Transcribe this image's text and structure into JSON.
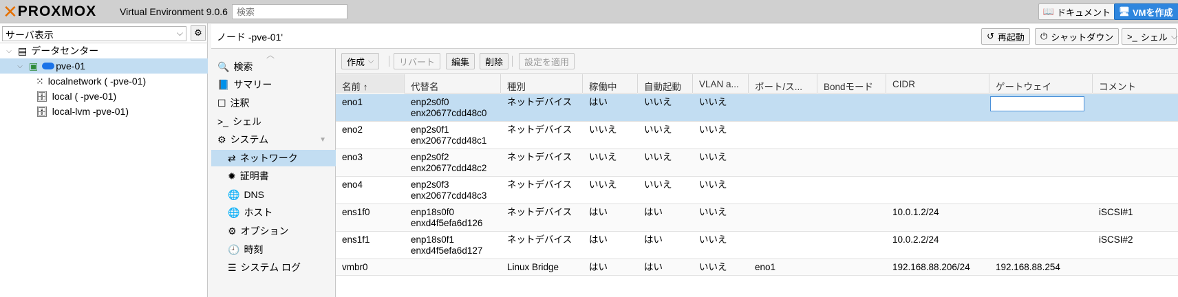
{
  "app": {
    "logo": "PROXMOX",
    "version": "Virtual Environment 9.0.6",
    "search_placeholder": "検索",
    "docs_label": "ドキュメント",
    "create_vm_label": "VMを作成"
  },
  "tree": {
    "view_label": "サーバ表示",
    "items": [
      {
        "label": "データセンター"
      },
      {
        "label": "pve-01"
      },
      {
        "label": "localnetwork (   -pve-01)"
      },
      {
        "label": "local (   -pve-01)"
      },
      {
        "label": "local-lvm   -pve-01)"
      }
    ]
  },
  "header": {
    "title": "ノード   -pve-01'",
    "reboot_label": "再起動",
    "shutdown_label": "シャットダウン",
    "shell_label": "シェル"
  },
  "nav": {
    "items": [
      {
        "label": "検索"
      },
      {
        "label": "サマリー"
      },
      {
        "label": "注釈"
      },
      {
        "label": "シェル"
      },
      {
        "label": "システム"
      },
      {
        "label": "ネットワーク"
      },
      {
        "label": "証明書"
      },
      {
        "label": "DNS"
      },
      {
        "label": "ホスト"
      },
      {
        "label": "オプション"
      },
      {
        "label": "時刻"
      },
      {
        "label": "システム ログ"
      }
    ]
  },
  "toolbar": {
    "create": "作成",
    "revert": "リバート",
    "edit": "編集",
    "delete": "削除",
    "apply": "設定を適用"
  },
  "table": {
    "columns": [
      "名前 ↑",
      "代替名",
      "種別",
      "稼働中",
      "自動起動",
      "VLAN a...",
      "ポート/ス...",
      "Bondモード",
      "CIDR",
      "ゲートウェイ",
      "コメント"
    ],
    "rows": [
      {
        "name": "eno1",
        "alt1": "enp2s0f0",
        "alt2": "enx20677cdd48c0",
        "type": "ネットデバイス",
        "active": "はい",
        "autostart": "いいえ",
        "vlan": "いいえ",
        "ports": "",
        "bond": "",
        "cidr": "",
        "gateway": "",
        "comment": ""
      },
      {
        "name": "eno2",
        "alt1": "enp2s0f1",
        "alt2": "enx20677cdd48c1",
        "type": "ネットデバイス",
        "active": "いいえ",
        "autostart": "いいえ",
        "vlan": "いいえ",
        "ports": "",
        "bond": "",
        "cidr": "",
        "gateway": "",
        "comment": ""
      },
      {
        "name": "eno3",
        "alt1": "enp2s0f2",
        "alt2": "enx20677cdd48c2",
        "type": "ネットデバイス",
        "active": "いいえ",
        "autostart": "いいえ",
        "vlan": "いいえ",
        "ports": "",
        "bond": "",
        "cidr": "",
        "gateway": "",
        "comment": ""
      },
      {
        "name": "eno4",
        "alt1": "enp2s0f3",
        "alt2": "enx20677cdd48c3",
        "type": "ネットデバイス",
        "active": "いいえ",
        "autostart": "いいえ",
        "vlan": "いいえ",
        "ports": "",
        "bond": "",
        "cidr": "",
        "gateway": "",
        "comment": ""
      },
      {
        "name": "ens1f0",
        "alt1": "enp18s0f0",
        "alt2": "enxd4f5efa6d126",
        "type": "ネットデバイス",
        "active": "はい",
        "autostart": "はい",
        "vlan": "いいえ",
        "ports": "",
        "bond": "",
        "cidr": "10.0.1.2/24",
        "gateway": "",
        "comment": "iSCSI#1"
      },
      {
        "name": "ens1f1",
        "alt1": "enp18s0f1",
        "alt2": "enxd4f5efa6d127",
        "type": "ネットデバイス",
        "active": "はい",
        "autostart": "はい",
        "vlan": "いいえ",
        "ports": "",
        "bond": "",
        "cidr": "10.0.2.2/24",
        "gateway": "",
        "comment": "iSCSI#2"
      },
      {
        "name": "vmbr0",
        "alt1": "",
        "alt2": "",
        "type": "Linux Bridge",
        "active": "はい",
        "autostart": "はい",
        "vlan": "いいえ",
        "ports": "eno1",
        "bond": "",
        "cidr": "192.168.88.206/24",
        "gateway": "192.168.88.254",
        "comment": ""
      }
    ]
  }
}
